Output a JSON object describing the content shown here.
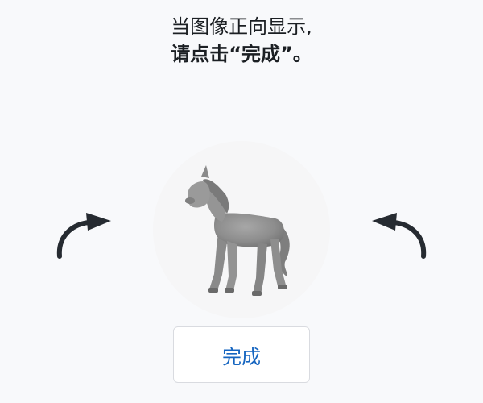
{
  "instruction": {
    "line1": "当图像正向显示,",
    "line2": "请点击“完成”。"
  },
  "controls": {
    "rotate_left_icon": "curved-arrow-left-icon",
    "rotate_right_icon": "curved-arrow-right-icon",
    "done_label": "完成"
  },
  "image": {
    "subject_icon": "horse-figurine-icon"
  },
  "colors": {
    "background": "#f8f9fb",
    "text": "#1b1f23",
    "accent": "#1565c0",
    "arrow": "#262b31"
  }
}
